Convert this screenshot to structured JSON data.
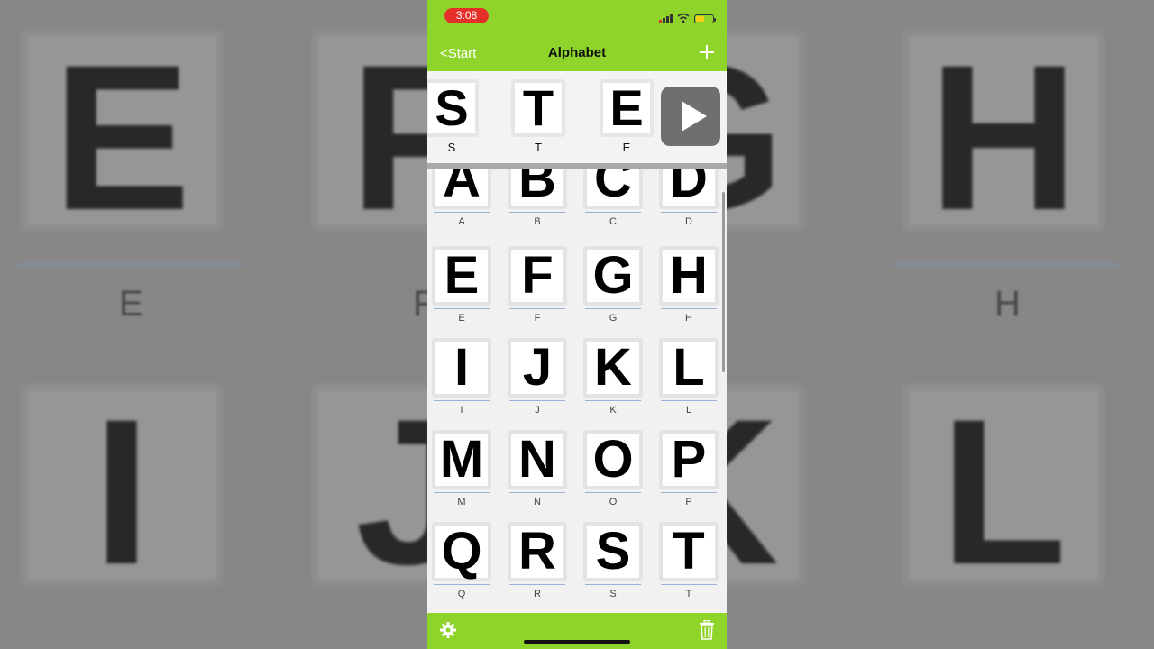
{
  "background": {
    "tiles": [
      "E",
      "F",
      "G",
      "H",
      "I",
      "J",
      "K",
      "L"
    ],
    "captions": [
      "E",
      "F",
      "H"
    ]
  },
  "status_bar": {
    "time": "3:08"
  },
  "nav": {
    "back_label": "<Start",
    "title": "Alphabet"
  },
  "sentence": [
    {
      "letter": "S",
      "label": "S"
    },
    {
      "letter": "T",
      "label": "T"
    },
    {
      "letter": "E",
      "label": "E"
    }
  ],
  "grid": [
    {
      "letter": "A",
      "label": "A"
    },
    {
      "letter": "B",
      "label": "B"
    },
    {
      "letter": "C",
      "label": "C"
    },
    {
      "letter": "D",
      "label": "D"
    },
    {
      "letter": "E",
      "label": "E"
    },
    {
      "letter": "F",
      "label": "F"
    },
    {
      "letter": "G",
      "label": "G"
    },
    {
      "letter": "H",
      "label": "H"
    },
    {
      "letter": "I",
      "label": "I"
    },
    {
      "letter": "J",
      "label": "J"
    },
    {
      "letter": "K",
      "label": "K"
    },
    {
      "letter": "L",
      "label": "L"
    },
    {
      "letter": "M",
      "label": "M"
    },
    {
      "letter": "N",
      "label": "N"
    },
    {
      "letter": "O",
      "label": "O"
    },
    {
      "letter": "P",
      "label": "P"
    },
    {
      "letter": "Q",
      "label": "Q"
    },
    {
      "letter": "R",
      "label": "R"
    },
    {
      "letter": "S",
      "label": "S"
    },
    {
      "letter": "T",
      "label": "T"
    }
  ],
  "colors": {
    "bar_green": "#8ed42b",
    "time_pill": "#e5302a",
    "play_button": "#6f6f6f"
  }
}
